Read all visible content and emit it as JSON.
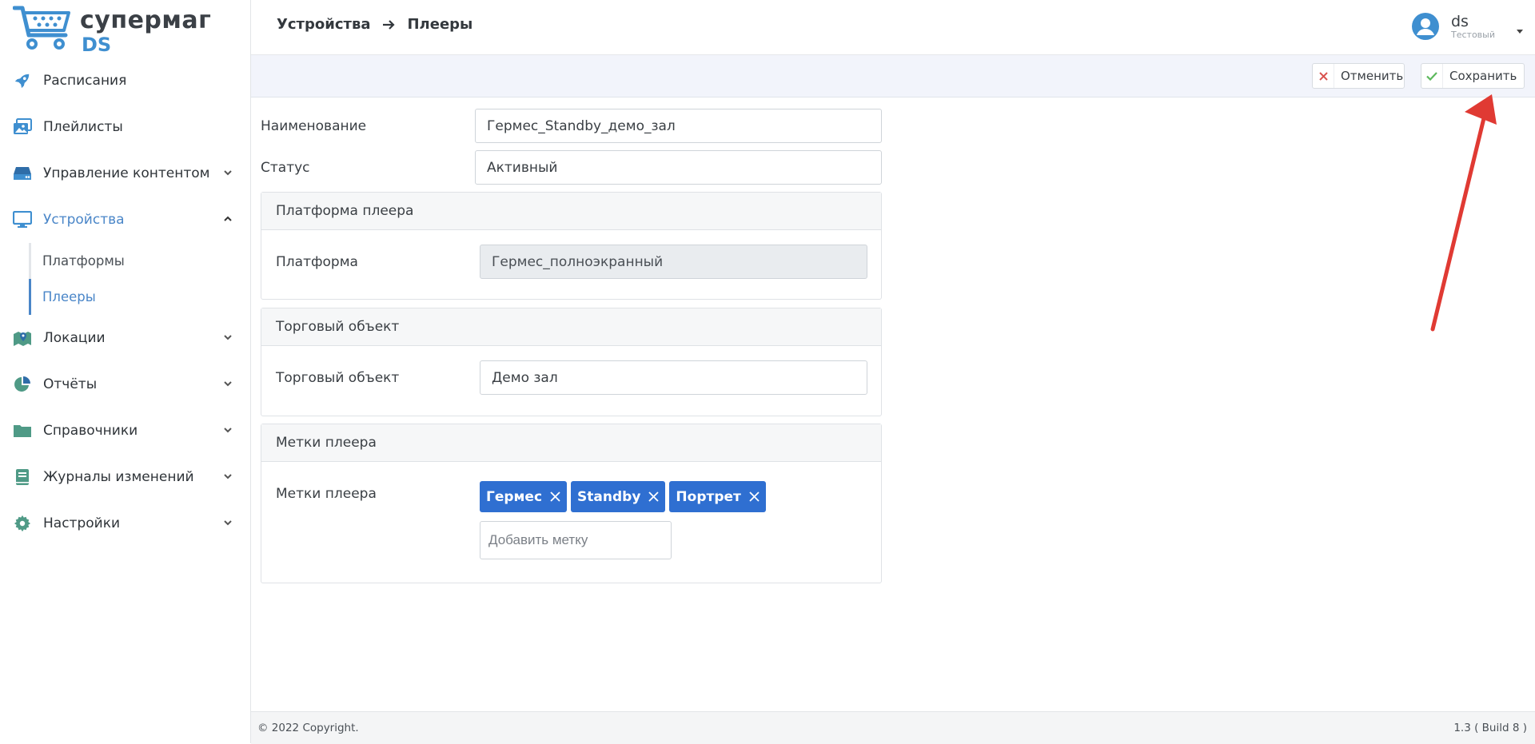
{
  "app": {
    "logo_line1": "супермаг",
    "logo_line2": "DS"
  },
  "sidebar": {
    "items": [
      {
        "label": "Расписания",
        "icon": "rocket-icon",
        "has_chevron": false
      },
      {
        "label": "Плейлисты",
        "icon": "images-icon",
        "has_chevron": false
      },
      {
        "label": "Управление контентом",
        "icon": "hdd-icon",
        "has_chevron": true
      },
      {
        "label": "Устройства",
        "icon": "monitor-icon",
        "has_chevron": true,
        "expanded": true
      },
      {
        "label": "Локации",
        "icon": "map-icon",
        "has_chevron": true
      },
      {
        "label": "Отчёты",
        "icon": "pie-chart-icon",
        "has_chevron": true
      },
      {
        "label": "Справочники",
        "icon": "folder-icon",
        "has_chevron": true
      },
      {
        "label": "Журналы изменений",
        "icon": "book-icon",
        "has_chevron": true
      },
      {
        "label": "Настройки",
        "icon": "gear-icon",
        "has_chevron": true
      }
    ],
    "sub_items": [
      {
        "label": "Платформы"
      },
      {
        "label": "Плееры",
        "active": true
      }
    ]
  },
  "header": {
    "breadcrumb_parent": "Устройства",
    "breadcrumb_current": "Плееры",
    "user_name": "ds",
    "user_sub": "Тестовый"
  },
  "toolbar": {
    "cancel_label": "Отменить",
    "save_label": "Сохранить"
  },
  "form": {
    "name_label": "Наименование",
    "name_value": "Гермес_Standby_демо_зал",
    "status_label": "Статус",
    "status_value": "Активный",
    "platform_panel_title": "Платформа плеера",
    "platform_label": "Платформа",
    "platform_value": "Гермес_полноэкранный",
    "store_panel_title": "Торговый объект",
    "store_label": "Торговый объект",
    "store_value": "Демо зал",
    "tags_panel_title": "Метки плеера",
    "tags_label": "Метки плеера",
    "tags": [
      "Гермес",
      "Standby",
      "Портрет"
    ],
    "tag_placeholder": "Добавить метку"
  },
  "footer": {
    "copyright": "© 2022 Copyright.",
    "build": "1.3 ( Build 8 )"
  },
  "colors": {
    "accent": "#4a86c8",
    "tag_bg": "#2f6fd1",
    "cancel_icon": "#d9534f",
    "save_icon": "#5cb85c",
    "icon_teal": "#4f9a86",
    "annotation_arrow": "#e03a33"
  }
}
